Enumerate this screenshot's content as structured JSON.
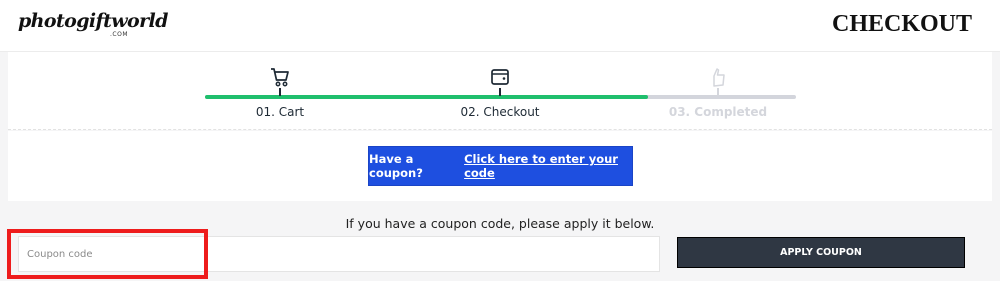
{
  "header": {
    "logo_text": "photogiftworld",
    "logo_sub": ".COM",
    "page_title": "CHECKOUT"
  },
  "progress": {
    "completed_fraction": 0.75,
    "steps": [
      {
        "label": "01. Cart",
        "icon": "cart-icon",
        "state": "done"
      },
      {
        "label": "02. Checkout",
        "icon": "wallet-icon",
        "state": "active"
      },
      {
        "label": "03. Completed",
        "icon": "hand-point-icon",
        "state": "inactive"
      }
    ]
  },
  "coupon_banner": {
    "prefix": "Have a coupon?",
    "link_text": "Click here to enter your code",
    "color": "#1e4fe0"
  },
  "coupon_form": {
    "help_text": "If you have a coupon code, please apply it below.",
    "input_placeholder": "Coupon code",
    "input_value": "",
    "apply_label": "APPLY COUPON"
  },
  "colors": {
    "progress_fill": "#1fbf6d",
    "progress_track": "#d3d5dc",
    "apply_button": "#2f3743",
    "highlight": "#ee1c1c"
  }
}
